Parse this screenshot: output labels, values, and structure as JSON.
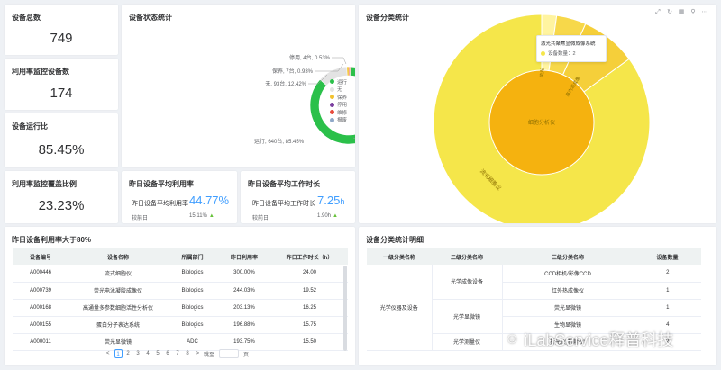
{
  "stats": {
    "total": {
      "label": "设备总数",
      "value": "749"
    },
    "monitored": {
      "label": "利用率监控设备数",
      "value": "174"
    },
    "running": {
      "label": "设备运行比",
      "value": "85.45%"
    },
    "coverage": {
      "label": "利用率监控覆盖比例",
      "value": "23.23%"
    }
  },
  "status_chart": {
    "title": "设备状态统计",
    "callouts": {
      "deactivated": "停用, 4台, 0.53%",
      "repair": "保养, 7台, 0.93%",
      "none": "无, 93台, 12.42%",
      "running": "运行, 640台, 85.45%"
    },
    "legend": [
      "运行",
      "无",
      "保养",
      "停用",
      "维修",
      "报废"
    ],
    "colors": {
      "running": "#2bc04a",
      "none": "#e3e3e3",
      "maintain": "#f2c12e",
      "stopped": "#7b3fa0",
      "repair": "#e84b3c",
      "scrap": "#8fa8c8"
    }
  },
  "chart_data": [
    {
      "type": "pie",
      "title": "设备状态统计",
      "slices": [
        {
          "label": "运行",
          "count": 640,
          "percent": 85.45
        },
        {
          "label": "无",
          "count": 93,
          "percent": 12.42
        },
        {
          "label": "保养",
          "count": 7,
          "percent": 0.93
        },
        {
          "label": "停用",
          "count": 4,
          "percent": 0.53
        }
      ],
      "legend": [
        "运行",
        "无",
        "保养",
        "停用",
        "维修",
        "报废"
      ]
    }
  ],
  "avg_util": {
    "title": "昨日设备平均利用率",
    "label": "昨日设备平均利用率",
    "value": "44.77%",
    "cmp_label": "较前日",
    "cmp_value": "15.11%"
  },
  "avg_hours": {
    "title": "昨日设备平均工作时长",
    "label": "昨日设备平均工作时长",
    "value": "7.25",
    "unit": "h",
    "cmp_label": "较前日",
    "cmp_value": "1.90h"
  },
  "category_chart": {
    "title": "设备分类统计",
    "tooltip_title": "激光共聚焦显微成像系统",
    "tooltip_row": "设备数量：2",
    "inner_label": "细胞分析仪",
    "outer_labels": [
      "流式细胞仪",
      "激光共聚焦",
      "高内涵成像",
      "荧光"
    ],
    "toolbar_icons": [
      "expand-icon",
      "refresh-icon",
      "data-view-icon",
      "filter-icon",
      "more-icon"
    ]
  },
  "util_table": {
    "title": "昨日设备利用率大于80%",
    "columns": [
      "设备编号",
      "设备名称",
      "所属部门",
      "昨日利用率",
      "昨日工作时长（h）"
    ],
    "rows": [
      [
        "A000446",
        "流式细胞仪",
        "Biologics",
        "300.00%",
        "24.00"
      ],
      [
        "A000739",
        "荧光电泳凝胶成像仪",
        "Biologics",
        "244.03%",
        "19.52"
      ],
      [
        "A000168",
        "高通量多参数细胞活性分析仪",
        "Biologics",
        "203.13%",
        "16.25"
      ],
      [
        "A000155",
        "蛋白分子表达系统",
        "Biologics",
        "196.88%",
        "15.75"
      ],
      [
        "A000011",
        "荧光显微镜",
        "ADC",
        "193.75%",
        "15.50"
      ]
    ],
    "pager": {
      "prev": "<",
      "pages": [
        "1",
        "2",
        "3",
        "4",
        "5",
        "6",
        "7",
        "8"
      ],
      "next": ">",
      "goto": "跳至",
      "unit": "页"
    }
  },
  "detail_table": {
    "title": "设备分类统计明细",
    "columns": [
      "一级分类名称",
      "二级分类名称",
      "三级分类名称",
      "设备数量"
    ],
    "l1": "光学仪器及设备",
    "l2": [
      "光学成像设备",
      "光学显微镜",
      "光学测量仪"
    ],
    "rows": [
      [
        "CCD相机/影像CCD",
        "2"
      ],
      [
        "红外热成像仪",
        "1"
      ],
      [
        "荧光显微镜",
        "1"
      ],
      [
        "生物显微镜",
        "4"
      ],
      [
        "折光仪(折射仪)",
        "2"
      ]
    ]
  },
  "watermark": "iLabService释普科技"
}
